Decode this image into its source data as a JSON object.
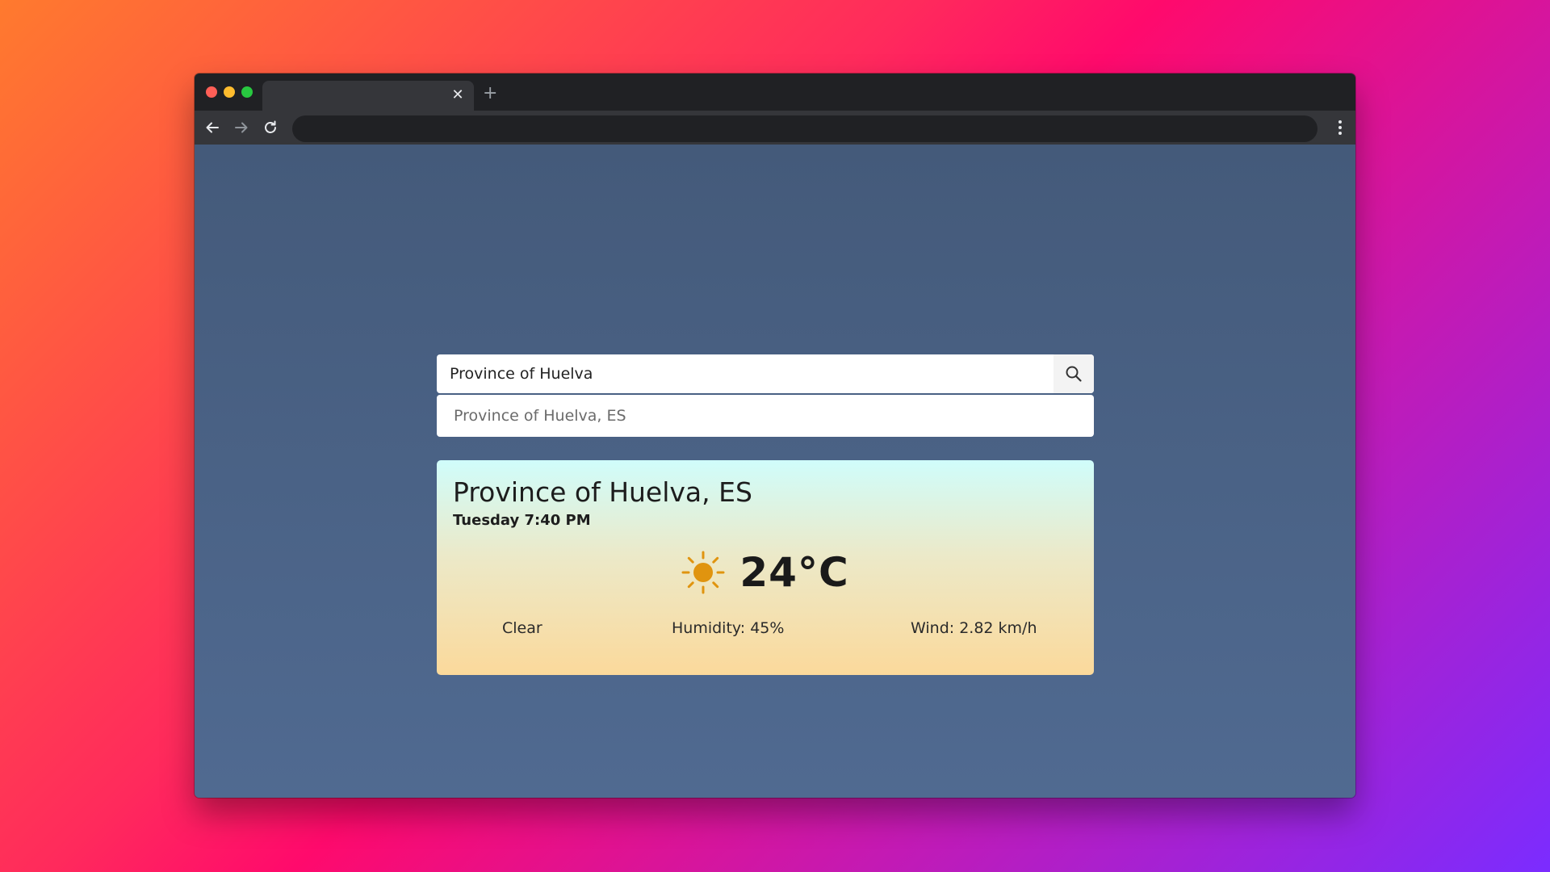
{
  "browser": {
    "tab": {
      "title": "",
      "close_icon": "close-icon"
    },
    "new_tab_icon": "plus-icon",
    "address": ""
  },
  "search": {
    "value": "Province of Huelva",
    "placeholder": "",
    "button_icon": "search-icon",
    "suggestions": [
      "Province of Huelva, ES"
    ]
  },
  "weather": {
    "city": "Province of Huelva, ES",
    "datetime": "Tuesday 7:40 PM",
    "icon": "sun-icon",
    "temperature": "24°C",
    "condition": "Clear",
    "humidity": "Humidity: 45%",
    "wind": "Wind: 2.82 km/h",
    "colors": {
      "icon": "#e0940f",
      "gradient_top": "#d0fdfb",
      "gradient_bottom": "#fbd99b"
    }
  }
}
